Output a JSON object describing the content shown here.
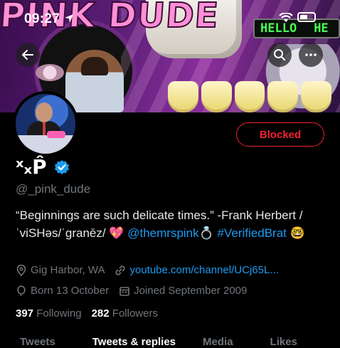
{
  "status_bar": {
    "time": "09:27"
  },
  "banner": {
    "title": "PINK DUDE",
    "sign_text_1": "HELLO",
    "sign_text_2": "HE"
  },
  "profile": {
    "display_name": "ˣₓP̂",
    "verified": true,
    "handle": "@_pink_dude",
    "action_button": "Blocked",
    "bio_text": "“Beginnings are such delicate times.” -Frank Herbert / ˈviSHəs/ˈɡranēz/ 💖",
    "bio_mention": "@themrspink💍",
    "bio_hashtag": "#VerifiedBrat",
    "bio_emoji": "🤓",
    "location": "Gig Harbor, WA",
    "link": "youtube.com/channel/UCj65L...",
    "birthday": "Born 13 October",
    "joined": "Joined September 2009",
    "following_count": "397",
    "following_label": "Following",
    "followers_count": "282",
    "followers_label": "Followers"
  },
  "tabs": [
    "Tweets",
    "Tweets & replies",
    "Media",
    "Likes"
  ],
  "icons": {
    "back": "arrow-left-icon",
    "search": "search-icon",
    "more": "more-icon",
    "location": "location-pin-icon",
    "link": "link-icon",
    "birthday": "balloon-icon",
    "joined": "calendar-icon",
    "verified": "verified-badge-icon"
  },
  "colors": {
    "accent": "#1d9bf0",
    "blocked": "#f4212e",
    "muted": "#71767b"
  }
}
